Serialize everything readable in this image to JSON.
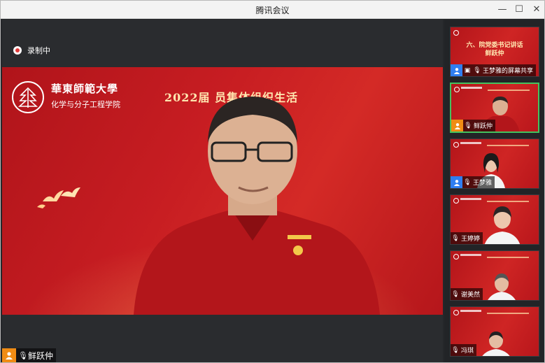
{
  "window": {
    "title": "腾讯会议",
    "min_icon": "minimize-icon",
    "max_icon": "maximize-icon",
    "close_icon": "close-icon"
  },
  "recording": {
    "label": "录制中",
    "icon": "record-icon"
  },
  "stage": {
    "logo_name": "華東師範大學",
    "logo_sub": "化学与分子工程学院",
    "banner_text": "2022届        员集体组织生活",
    "speaker": {
      "name": "鲜跃仲",
      "mic_icon": "microphone-icon",
      "avatar_icon": "user-icon"
    }
  },
  "sidebar": {
    "tiles": [
      {
        "name": "王梦雅的屏幕共享",
        "slide_line1": "六、院党委书记讲话",
        "slide_line2": "鲜跃仲",
        "avatar_color": "#2f7ef1",
        "icon": "screen-share-icon",
        "active": false
      },
      {
        "name": "鲜跃仲",
        "avatar_color": "#f08c14",
        "icon": "microphone-icon",
        "active": true
      },
      {
        "name": "王梦雅",
        "avatar_color": "#2f7ef1",
        "icon": "mic-muted-icon",
        "active": false
      },
      {
        "name": "王婷婷",
        "icon": "mic-muted-icon",
        "active": false
      },
      {
        "name": "谢美然",
        "icon": "mic-muted-icon",
        "active": false
      },
      {
        "name": "冯琪",
        "icon": "mic-muted-icon",
        "active": false
      }
    ]
  },
  "colors": {
    "slide_red": "#c71d22",
    "active_border": "#44c25e",
    "avatar_blue": "#2f7ef1",
    "avatar_orange": "#f08c14"
  }
}
